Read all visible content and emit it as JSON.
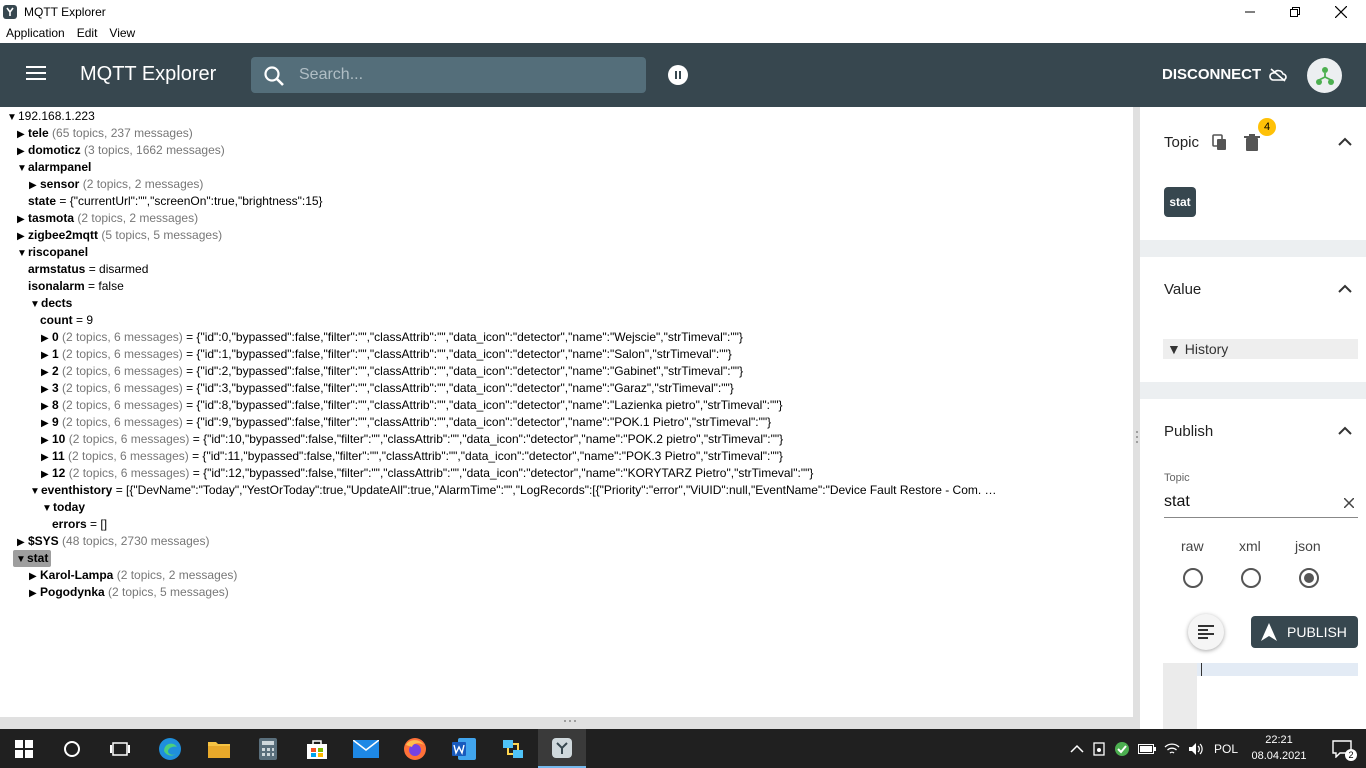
{
  "window": {
    "title": "MQTT Explorer"
  },
  "menu": {
    "items": [
      "Application",
      "Edit",
      "View"
    ]
  },
  "header": {
    "title": "MQTT Explorer",
    "search_placeholder": "Search...",
    "disconnect_label": "DISCONNECT"
  },
  "tree": {
    "rows": [
      {
        "id": "root",
        "toggle": "▼",
        "name": "192.168.1.223",
        "meta": "",
        "value": ""
      },
      {
        "id": "tele",
        "toggle": "▶",
        "name": "tele",
        "meta": "(65 topics, 237 messages)",
        "value": ""
      },
      {
        "id": "domoticz",
        "toggle": "▶",
        "name": "domoticz",
        "meta": "(3 topics, 1662 messages)",
        "value": ""
      },
      {
        "id": "alarmpanel",
        "toggle": "▼",
        "name": "alarmpanel",
        "meta": "",
        "value": ""
      },
      {
        "id": "sensor",
        "toggle": "▶",
        "name": "sensor",
        "meta": "(2 topics, 2 messages)",
        "value": ""
      },
      {
        "id": "state",
        "toggle": "",
        "name": "state",
        "meta": "",
        "value": "= {\"currentUrl\":\"\",\"screenOn\":true,\"brightness\":15}"
      },
      {
        "id": "tasmota",
        "toggle": "▶",
        "name": "tasmota",
        "meta": "(2 topics, 2 messages)",
        "value": ""
      },
      {
        "id": "zigbee2mqtt",
        "toggle": "▶",
        "name": "zigbee2mqtt",
        "meta": "(5 topics, 5 messages)",
        "value": ""
      },
      {
        "id": "riscopanel",
        "toggle": "▼",
        "name": "riscopanel",
        "meta": "",
        "value": ""
      },
      {
        "id": "armstatus",
        "toggle": "",
        "name": "armstatus",
        "meta": "",
        "value": "= disarmed"
      },
      {
        "id": "isonalarm",
        "toggle": "",
        "name": "isonalarm",
        "meta": "",
        "value": "= false"
      },
      {
        "id": "dects",
        "toggle": "▼",
        "name": "dects",
        "meta": "",
        "value": ""
      },
      {
        "id": "count",
        "toggle": "",
        "name": "count",
        "meta": "",
        "value": "= 9"
      },
      {
        "id": "d0",
        "toggle": "▶",
        "name": "0",
        "meta": "(2 topics, 6 messages)",
        "value": "= {\"id\":0,\"bypassed\":false,\"filter\":\"\",\"classAttrib\":\"\",\"data_icon\":\"detector\",\"name\":\"Wejscie\",\"strTimeval\":\"\"}"
      },
      {
        "id": "d1",
        "toggle": "▶",
        "name": "1",
        "meta": "(2 topics, 6 messages)",
        "value": "= {\"id\":1,\"bypassed\":false,\"filter\":\"\",\"classAttrib\":\"\",\"data_icon\":\"detector\",\"name\":\"Salon\",\"strTimeval\":\"\"}"
      },
      {
        "id": "d2",
        "toggle": "▶",
        "name": "2",
        "meta": "(2 topics, 6 messages)",
        "value": "= {\"id\":2,\"bypassed\":false,\"filter\":\"\",\"classAttrib\":\"\",\"data_icon\":\"detector\",\"name\":\"Gabinet\",\"strTimeval\":\"\"}"
      },
      {
        "id": "d3",
        "toggle": "▶",
        "name": "3",
        "meta": "(2 topics, 6 messages)",
        "value": "= {\"id\":3,\"bypassed\":false,\"filter\":\"\",\"classAttrib\":\"\",\"data_icon\":\"detector\",\"name\":\"Garaz\",\"strTimeval\":\"\"}"
      },
      {
        "id": "d8",
        "toggle": "▶",
        "name": "8",
        "meta": "(2 topics, 6 messages)",
        "value": "= {\"id\":8,\"bypassed\":false,\"filter\":\"\",\"classAttrib\":\"\",\"data_icon\":\"detector\",\"name\":\"Lazienka pietro\",\"strTimeval\":\"\"}"
      },
      {
        "id": "d9",
        "toggle": "▶",
        "name": "9",
        "meta": "(2 topics, 6 messages)",
        "value": "= {\"id\":9,\"bypassed\":false,\"filter\":\"\",\"classAttrib\":\"\",\"data_icon\":\"detector\",\"name\":\"POK.1 Pietro\",\"strTimeval\":\"\"}"
      },
      {
        "id": "d10",
        "toggle": "▶",
        "name": "10",
        "meta": "(2 topics, 6 messages)",
        "value": "= {\"id\":10,\"bypassed\":false,\"filter\":\"\",\"classAttrib\":\"\",\"data_icon\":\"detector\",\"name\":\"POK.2 pietro\",\"strTimeval\":\"\"}"
      },
      {
        "id": "d11",
        "toggle": "▶",
        "name": "11",
        "meta": "(2 topics, 6 messages)",
        "value": "= {\"id\":11,\"bypassed\":false,\"filter\":\"\",\"classAttrib\":\"\",\"data_icon\":\"detector\",\"name\":\"POK.3 Pietro\",\"strTimeval\":\"\"}"
      },
      {
        "id": "d12",
        "toggle": "▶",
        "name": "12",
        "meta": "(2 topics, 6 messages)",
        "value": "= {\"id\":12,\"bypassed\":false,\"filter\":\"\",\"classAttrib\":\"\",\"data_icon\":\"detector\",\"name\":\"KORYTARZ Pietro\",\"strTimeval\":\"\"}"
      },
      {
        "id": "eventhistory",
        "toggle": "▼",
        "name": "eventhistory",
        "meta": "",
        "value": "= [{\"DevName\":\"Today\",\"YestOrToday\":true,\"UpdateAll\":true,\"AlarmTime\":\"\",\"LogRecords\":[{\"Priority\":\"error\",\"ViUID\":null,\"EventName\":\"Device Fault Restore - Com. …"
      },
      {
        "id": "today",
        "toggle": "▼",
        "name": "today",
        "meta": "",
        "value": ""
      },
      {
        "id": "errors",
        "toggle": "",
        "name": "errors",
        "meta": "",
        "value": "= []"
      },
      {
        "id": "sys",
        "toggle": "▶",
        "name": "$SYS",
        "meta": "(48 topics, 2730 messages)",
        "value": ""
      },
      {
        "id": "stat",
        "toggle": "▼",
        "name": "stat",
        "meta": "",
        "value": ""
      },
      {
        "id": "karol",
        "toggle": "▶",
        "name": "Karol-Lampa",
        "meta": "(2 topics, 2 messages)",
        "value": ""
      },
      {
        "id": "pogodynka",
        "toggle": "▶",
        "name": "Pogodynka",
        "meta": "(2 topics, 5 messages)",
        "value": ""
      }
    ]
  },
  "sidebar": {
    "topic": {
      "title": "Topic",
      "badge": "4",
      "chip": "stat"
    },
    "value": {
      "title": "Value",
      "history_label": "History"
    },
    "publish": {
      "title": "Publish",
      "topic_label": "Topic",
      "topic_value": "stat",
      "formats": [
        {
          "label": "raw",
          "selected": false
        },
        {
          "label": "xml",
          "selected": false
        },
        {
          "label": "json",
          "selected": true
        }
      ],
      "publish_label": "PUBLISH"
    }
  },
  "taskbar": {
    "lang": "POL",
    "time": "22:21",
    "date": "08.04.2021",
    "notifications": "2"
  },
  "colors": {
    "appbar": "#37474f",
    "search": "#546e7a",
    "badge": "#ffc107",
    "taskbar": "#202020"
  }
}
